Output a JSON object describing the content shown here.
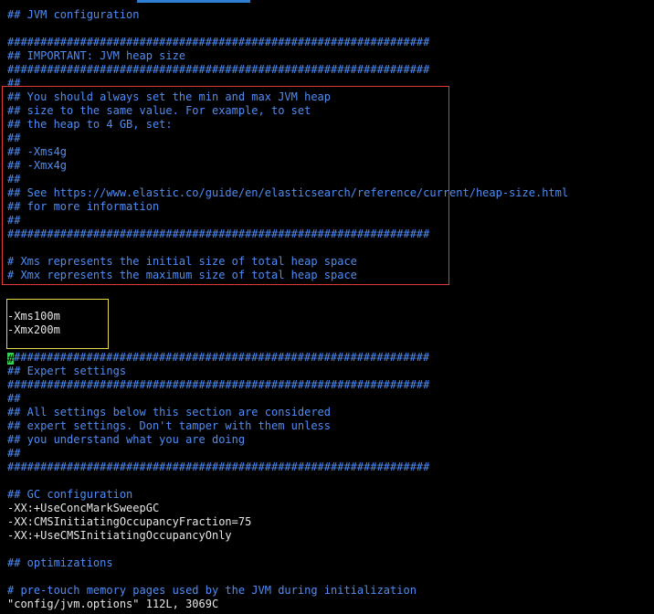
{
  "editor": {
    "lines": [
      {
        "text": "## JVM configuration",
        "kind": "comment"
      },
      {
        "text": "",
        "kind": "blank"
      },
      {
        "text": "################################################################",
        "kind": "comment"
      },
      {
        "text": "## IMPORTANT: JVM heap size",
        "kind": "comment"
      },
      {
        "text": "################################################################",
        "kind": "comment"
      },
      {
        "text": "##",
        "kind": "comment"
      },
      {
        "text": "## You should always set the min and max JVM heap",
        "kind": "comment"
      },
      {
        "text": "## size to the same value. For example, to set",
        "kind": "comment"
      },
      {
        "text": "## the heap to 4 GB, set:",
        "kind": "comment"
      },
      {
        "text": "##",
        "kind": "comment"
      },
      {
        "text": "## -Xms4g",
        "kind": "comment"
      },
      {
        "text": "## -Xmx4g",
        "kind": "comment"
      },
      {
        "text": "##",
        "kind": "comment"
      },
      {
        "text": "## See https://www.elastic.co/guide/en/elasticsearch/reference/current/heap-size.html",
        "kind": "comment"
      },
      {
        "text": "## for more information",
        "kind": "comment"
      },
      {
        "text": "##",
        "kind": "comment"
      },
      {
        "text": "################################################################",
        "kind": "comment"
      },
      {
        "text": "",
        "kind": "blank"
      },
      {
        "text": "# Xms represents the initial size of total heap space",
        "kind": "comment"
      },
      {
        "text": "# Xmx represents the maximum size of total heap space",
        "kind": "comment"
      },
      {
        "text": "",
        "kind": "blank"
      },
      {
        "text": "",
        "kind": "blank"
      },
      {
        "text": "-Xms100m",
        "kind": "text"
      },
      {
        "text": "-Xmx200m",
        "kind": "text"
      },
      {
        "text": "",
        "kind": "blank"
      },
      {
        "text": "################################################################",
        "kind": "cursor-comment"
      },
      {
        "text": "## Expert settings",
        "kind": "comment"
      },
      {
        "text": "################################################################",
        "kind": "comment"
      },
      {
        "text": "##",
        "kind": "comment"
      },
      {
        "text": "## All settings below this section are considered",
        "kind": "comment"
      },
      {
        "text": "## expert settings. Don't tamper with them unless",
        "kind": "comment"
      },
      {
        "text": "## you understand what you are doing",
        "kind": "comment"
      },
      {
        "text": "##",
        "kind": "comment"
      },
      {
        "text": "################################################################",
        "kind": "comment"
      },
      {
        "text": "",
        "kind": "blank"
      },
      {
        "text": "## GC configuration",
        "kind": "comment"
      },
      {
        "text": "-XX:+UseConcMarkSweepGC",
        "kind": "text"
      },
      {
        "text": "-XX:CMSInitiatingOccupancyFraction=75",
        "kind": "text"
      },
      {
        "text": "-XX:+UseCMSInitiatingOccupancyOnly",
        "kind": "text"
      },
      {
        "text": "",
        "kind": "blank"
      },
      {
        "text": "## optimizations",
        "kind": "comment"
      },
      {
        "text": "",
        "kind": "blank"
      },
      {
        "text": "# pre-touch memory pages used by the JVM during initialization",
        "kind": "comment"
      }
    ]
  },
  "status_line": "\"config/jvm.options\" 112L, 3069C",
  "colors": {
    "comment": "#4f8df5",
    "text": "#e6e6e6",
    "background": "#000000",
    "cursor": "#39d353",
    "red_box": "#e03a3a",
    "yellow_box": "#e6d84a"
  }
}
